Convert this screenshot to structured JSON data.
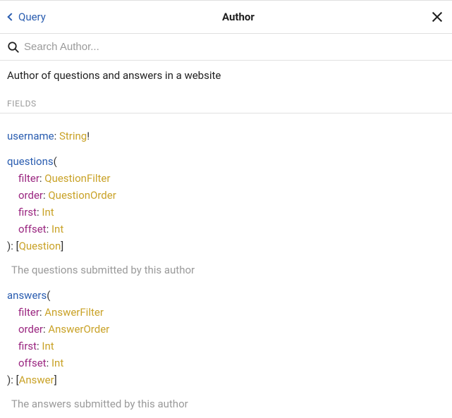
{
  "header": {
    "back_label": "Query",
    "title": "Author"
  },
  "search": {
    "placeholder": "Search Author..."
  },
  "description": "Author of questions and answers in a website",
  "section_label": "FIELDS",
  "fields": {
    "username": {
      "name": "username",
      "type": "String",
      "nonnull": "!"
    },
    "questions": {
      "name": "questions",
      "args": {
        "filter": {
          "name": "filter",
          "type": "QuestionFilter"
        },
        "order": {
          "name": "order",
          "type": "QuestionOrder"
        },
        "first": {
          "name": "first",
          "type": "Int"
        },
        "offset": {
          "name": "offset",
          "type": "Int"
        }
      },
      "return_type": "Question",
      "description": "The questions submitted by this author"
    },
    "answers": {
      "name": "answers",
      "args": {
        "filter": {
          "name": "filter",
          "type": "AnswerFilter"
        },
        "order": {
          "name": "order",
          "type": "AnswerOrder"
        },
        "first": {
          "name": "first",
          "type": "Int"
        },
        "offset": {
          "name": "offset",
          "type": "Int"
        }
      },
      "return_type": "Answer",
      "description": "The answers submitted by this author"
    }
  }
}
